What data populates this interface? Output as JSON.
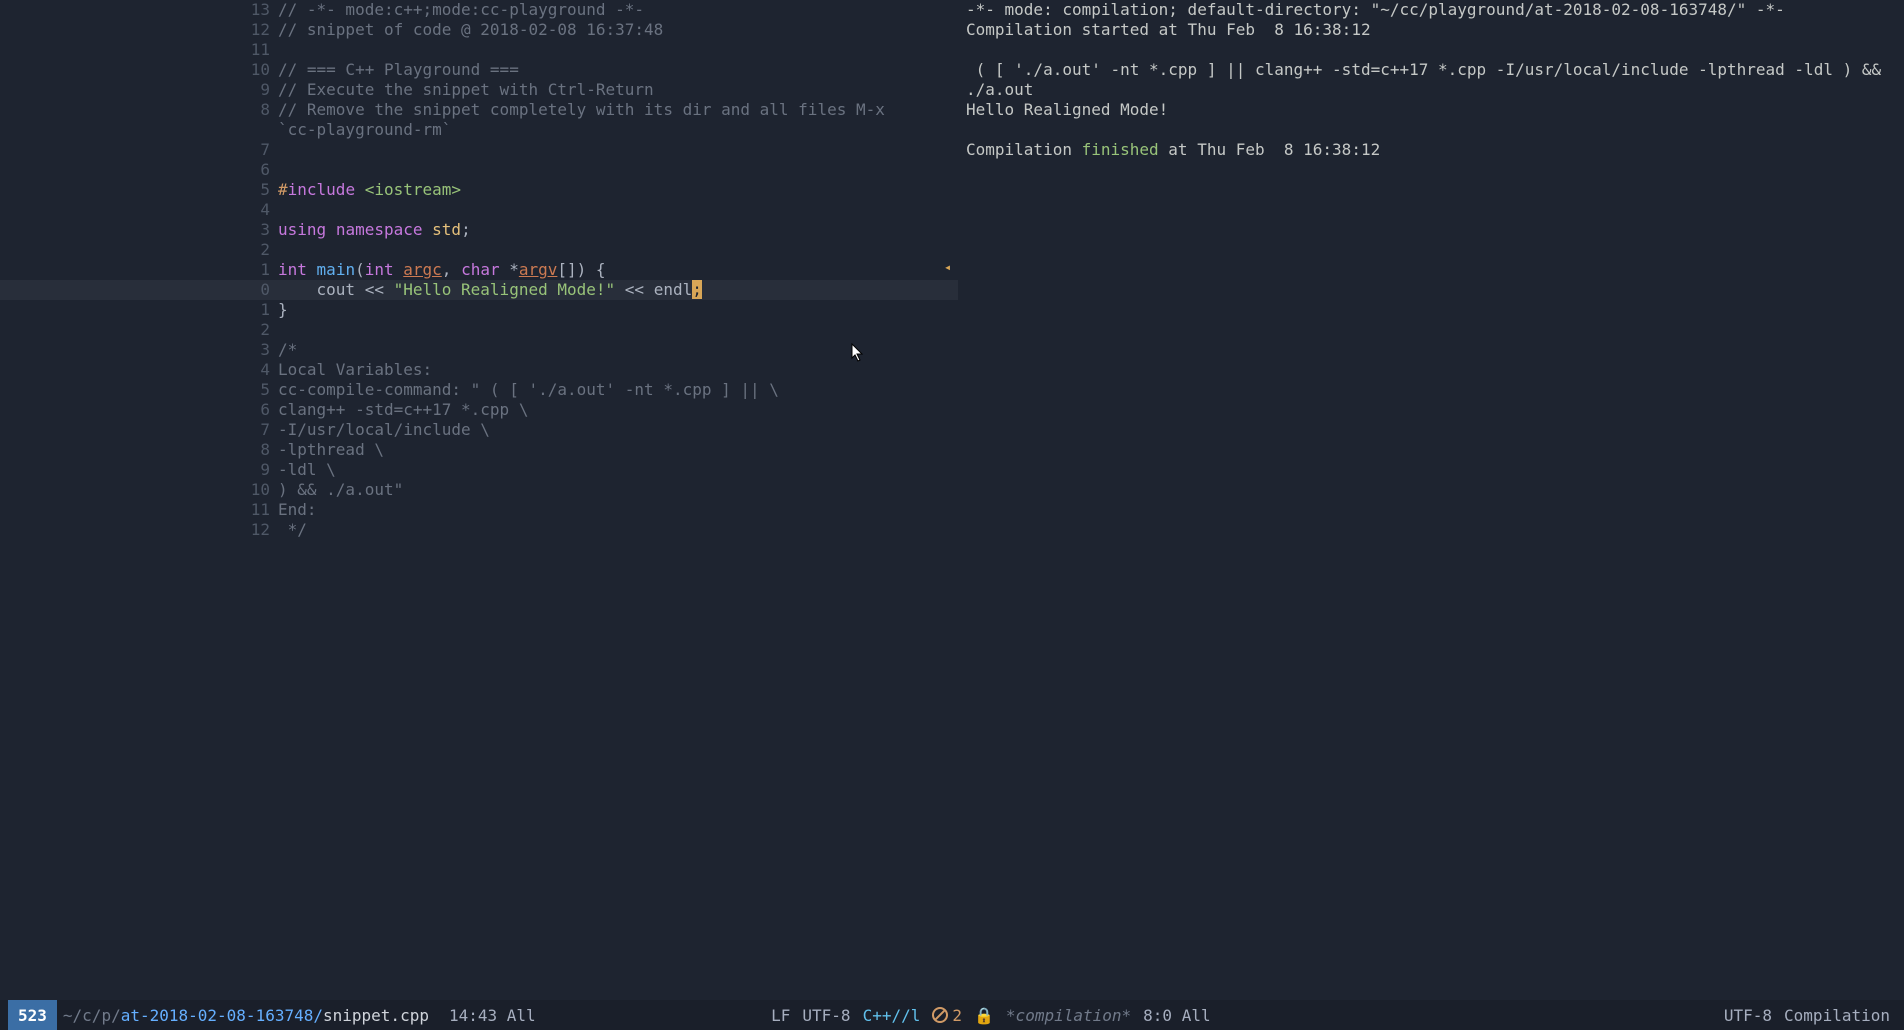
{
  "editor": {
    "lines": [
      {
        "num": "13",
        "segments": [
          {
            "t": "// -*- mode:c++;mode:cc-playground -*-",
            "c": "comment"
          }
        ]
      },
      {
        "num": "12",
        "segments": [
          {
            "t": "// snippet of code @ 2018-02-08 16:37:48",
            "c": "comment"
          }
        ]
      },
      {
        "num": "11",
        "segments": []
      },
      {
        "num": "10",
        "segments": [
          {
            "t": "// === C++ Playground ===",
            "c": "comment"
          }
        ]
      },
      {
        "num": "9",
        "segments": [
          {
            "t": "// Execute the snippet with Ctrl-Return",
            "c": "comment"
          }
        ]
      },
      {
        "num": "8",
        "segments": [
          {
            "t": "// Remove the snippet completely with its dir and all files M-x `cc-playground-rm`",
            "c": "comment",
            "wrap": true
          }
        ]
      },
      {
        "num": "7",
        "segments": []
      },
      {
        "num": "6",
        "segments": []
      },
      {
        "num": "5",
        "segments": [
          {
            "t": "#",
            "c": "keyword-pp"
          },
          {
            "t": "include",
            "c": "keyword-pp-name"
          },
          {
            "t": " ",
            "c": "default-txt"
          },
          {
            "t": "<iostream>",
            "c": "angle-lit"
          }
        ]
      },
      {
        "num": "4",
        "segments": []
      },
      {
        "num": "3",
        "segments": [
          {
            "t": "using",
            "c": "keyword"
          },
          {
            "t": " ",
            "c": "default-txt"
          },
          {
            "t": "namespace",
            "c": "keyword"
          },
          {
            "t": " ",
            "c": "default-txt"
          },
          {
            "t": "std",
            "c": "ident-ns"
          },
          {
            "t": ";",
            "c": "default-txt"
          }
        ]
      },
      {
        "num": "2",
        "segments": []
      },
      {
        "num": "1",
        "segments": [
          {
            "t": "int",
            "c": "type"
          },
          {
            "t": " ",
            "c": "default-txt"
          },
          {
            "t": "main",
            "c": "fn-name"
          },
          {
            "t": "(",
            "c": "default-txt"
          },
          {
            "t": "int",
            "c": "param-type"
          },
          {
            "t": " ",
            "c": "default-txt"
          },
          {
            "t": "argc",
            "c": "param-name underline"
          },
          {
            "t": ", ",
            "c": "default-txt"
          },
          {
            "t": "char",
            "c": "param-type"
          },
          {
            "t": " *",
            "c": "default-txt"
          },
          {
            "t": "argv",
            "c": "param-name underline"
          },
          {
            "t": "[]) {",
            "c": "default-txt"
          }
        ]
      },
      {
        "num": "0",
        "current": true,
        "segments": [
          {
            "t": "    cout << ",
            "c": "default-txt"
          },
          {
            "t": "\"Hello Realigned Mode!\"",
            "c": "string-lit"
          },
          {
            "t": " << endl",
            "c": "default-txt"
          },
          {
            "t": ";",
            "c": "cursor-block"
          }
        ]
      },
      {
        "num": "1",
        "segments": [
          {
            "t": "}",
            "c": "default-txt"
          }
        ]
      },
      {
        "num": "2",
        "segments": []
      },
      {
        "num": "3",
        "segments": [
          {
            "t": "/*",
            "c": "comment"
          }
        ]
      },
      {
        "num": "4",
        "segments": [
          {
            "t": "Local Variables:",
            "c": "comment"
          }
        ]
      },
      {
        "num": "5",
        "segments": [
          {
            "t": "cc-compile-command: \" ( [ './a.out' -nt *.cpp ] || \\",
            "c": "comment"
          }
        ]
      },
      {
        "num": "6",
        "segments": [
          {
            "t": "clang++ -std=c++17 *.cpp \\",
            "c": "comment"
          }
        ]
      },
      {
        "num": "7",
        "segments": [
          {
            "t": "-I/usr/local/include \\",
            "c": "comment"
          }
        ]
      },
      {
        "num": "8",
        "segments": [
          {
            "t": "-lpthread \\",
            "c": "comment"
          }
        ]
      },
      {
        "num": "9",
        "segments": [
          {
            "t": "-ldl \\",
            "c": "comment"
          }
        ]
      },
      {
        "num": "10",
        "segments": [
          {
            "t": ") && ./a.out\"",
            "c": "comment"
          }
        ]
      },
      {
        "num": "11",
        "segments": [
          {
            "t": "End:",
            "c": "comment"
          }
        ]
      },
      {
        "num": "12",
        "segments": [
          {
            "t": " */",
            "c": "comment"
          }
        ]
      }
    ],
    "fold_marker": "◂"
  },
  "compilation": {
    "lines": [
      {
        "segments": [
          {
            "t": "-*- mode: compilation; default-directory: \"~/cc/playground/at-2018-02-08-163748/\" -*-",
            "c": ""
          }
        ]
      },
      {
        "segments": [
          {
            "t": "Compilation started at Thu Feb  8 16:38:12",
            "c": ""
          }
        ]
      },
      {
        "segments": []
      },
      {
        "segments": [
          {
            "t": " ( [ './a.out' -nt *.cpp ] || clang++ -std=c++17 *.cpp -I/usr/local/include -lpthread -ldl ) && ./a.out",
            "c": "",
            "wrap": true
          }
        ]
      },
      {
        "segments": [
          {
            "t": "Hello Realigned Mode!",
            "c": ""
          }
        ]
      },
      {
        "segments": []
      },
      {
        "segments": [
          {
            "t": "Compilation ",
            "c": ""
          },
          {
            "t": "finished",
            "c": "comp-finished"
          },
          {
            "t": " at Thu Feb  8 16:38:12",
            "c": ""
          }
        ]
      }
    ]
  },
  "modeline_left": {
    "project": "523",
    "path_prefix": "~/c/p/",
    "path_highlight": "at-2018-02-08-163748/",
    "file": "snippet.cpp",
    "cursor_pos": "14:43",
    "scroll": "All",
    "lf": "LF",
    "enc": "UTF-8",
    "mode": "C++//l",
    "warn_count": "2"
  },
  "modeline_right": {
    "lock": "🔒",
    "buffer": "*compilation*",
    "cursor_pos": "8:0",
    "scroll": "All",
    "enc": "UTF-8",
    "mode": "Compilation"
  }
}
